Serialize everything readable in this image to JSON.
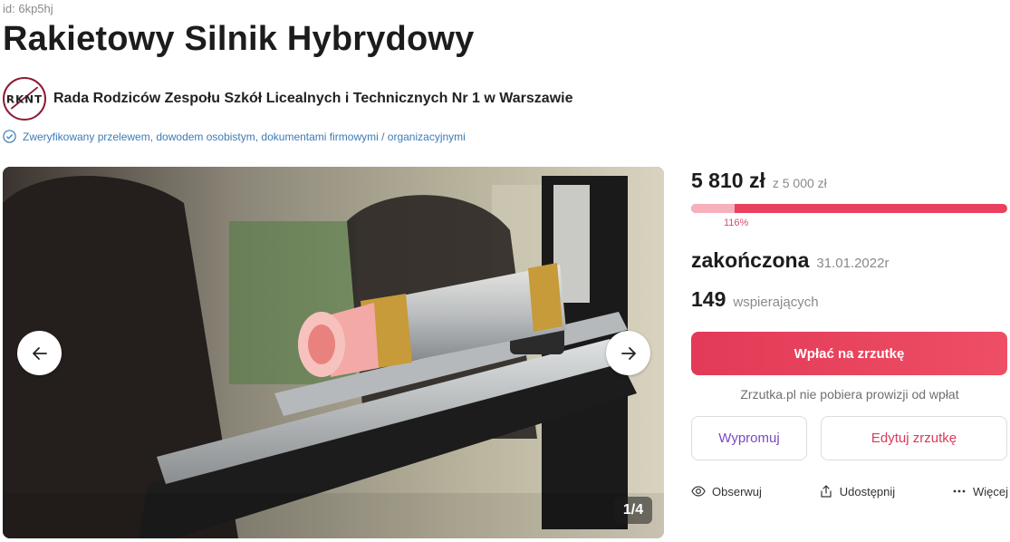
{
  "campaign": {
    "id_label": "id: 6kp5hj",
    "title": "Rakietowy Silnik Hybrydowy"
  },
  "organizer": {
    "logo_text": "RKNT",
    "name": "Rada Rodziców Zespołu Szkół Licealnych i Technicznych Nr 1 w Warszawie",
    "verified_text": "Zweryfikowany przelewem, dowodem osobistym, dokumentami firmowymi / organizacyjnymi"
  },
  "gallery": {
    "counter": "1/4",
    "prev_icon": "arrow-left-icon",
    "next_icon": "arrow-right-icon"
  },
  "funding": {
    "amount": "5 810 zł",
    "goal": "z 5 000 zł",
    "percent": "116%",
    "progress_fraction": 1.16,
    "status": "zakończona",
    "end_date": "31.01.2022r",
    "supporters_count": "149",
    "supporters_label": "wspierających"
  },
  "buttons": {
    "pay": "Wpłać na zrzutkę",
    "no_fee_note": "Zrzutka.pl nie pobiera prowizji od wpłat",
    "promote": "Wypromuj",
    "edit": "Edytuj zrzutkę"
  },
  "actions": [
    {
      "label": "Obserwuj",
      "icon": "eye-icon"
    },
    {
      "label": "Udostępnij",
      "icon": "share-icon"
    },
    {
      "label": "Więcej",
      "icon": "more-dots-icon"
    }
  ],
  "colors": {
    "accent": "#e9405f",
    "progress_light": "#f6b1bd",
    "promote": "#7a49c2",
    "verified": "#3d7bb6"
  }
}
